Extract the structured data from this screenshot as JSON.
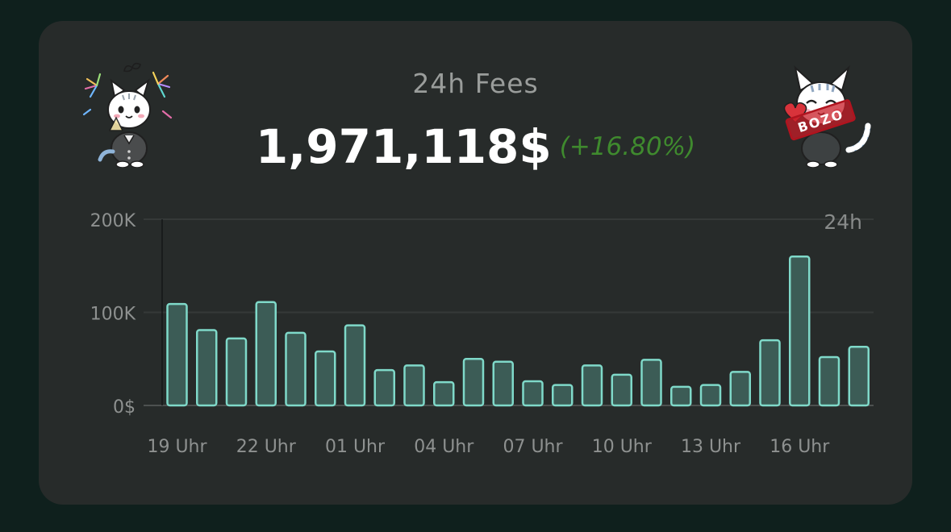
{
  "card": {
    "title": "24h Fees",
    "total": "1,971,118$",
    "change": "(+16.80%)",
    "left_mascot_icon": "celebrating-cat-icon",
    "right_mascot_icon": "bozo-cat-icon",
    "stamp_text": "BOZO"
  },
  "colors": {
    "background": "#0f201d",
    "card": "#272b2a",
    "bar_fill": "#3c5c56",
    "bar_stroke": "#7fd9c9",
    "change_positive": "#3f8a2e"
  },
  "chart_data": {
    "type": "bar",
    "period_label": "24h",
    "values": [
      109000,
      81000,
      72000,
      111000,
      78000,
      58000,
      86000,
      38000,
      43000,
      25000,
      50000,
      47000,
      26000,
      22000,
      43000,
      33000,
      49000,
      20000,
      22000,
      36000,
      70000,
      160000,
      52000,
      63000
    ],
    "x_tick_labels": [
      "19 Uhr",
      "22 Uhr",
      "01 Uhr",
      "04 Uhr",
      "07 Uhr",
      "10 Uhr",
      "13 Uhr",
      "16 Uhr"
    ],
    "y_tick_labels": [
      "0$",
      "100K",
      "200K"
    ],
    "y_ticks": [
      0,
      100000,
      200000
    ],
    "ylim": [
      0,
      200000
    ],
    "grid": true,
    "xlabel": "",
    "ylabel": ""
  }
}
